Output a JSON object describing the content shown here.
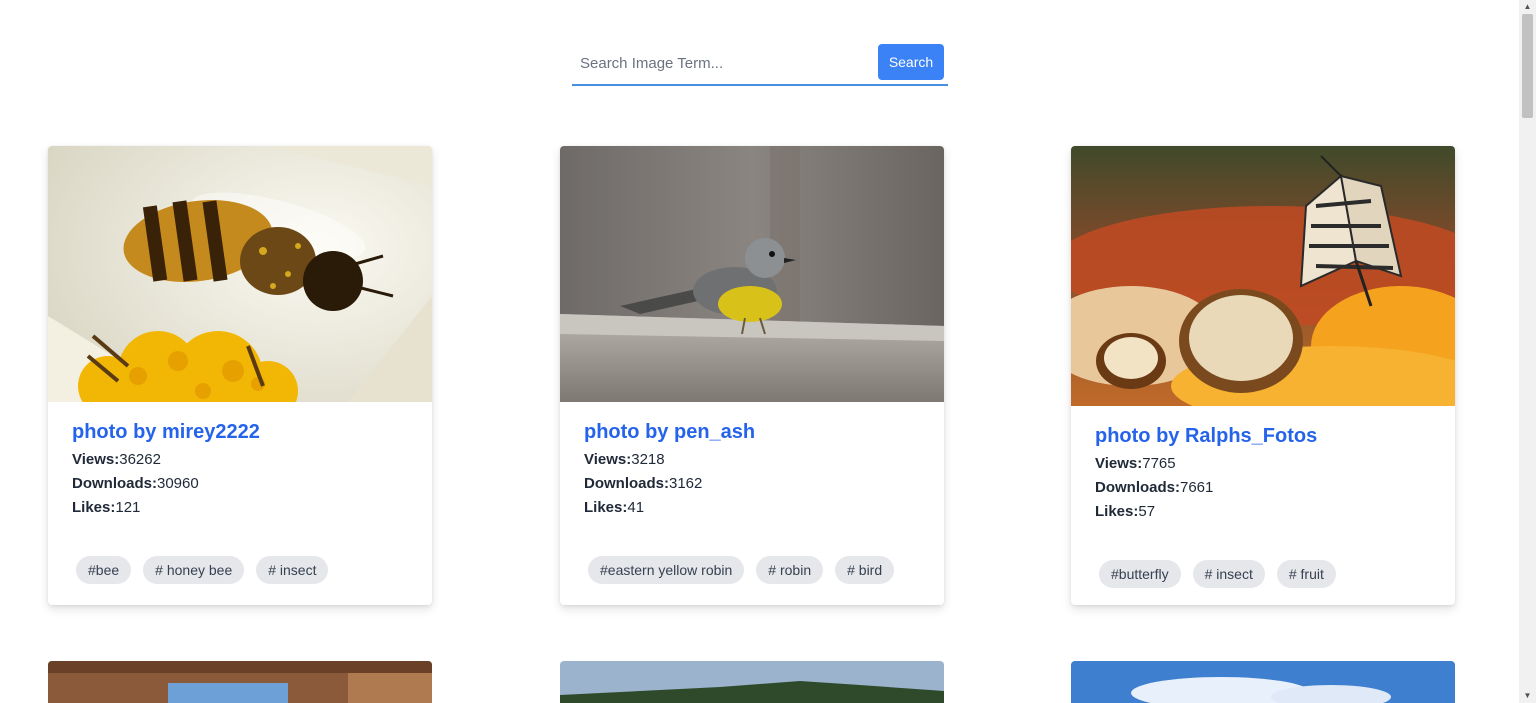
{
  "search": {
    "placeholder": "Search Image Term...",
    "value": "",
    "button_label": "Search"
  },
  "cards": [
    {
      "title": "photo by mirey2222",
      "views_label": "Views:",
      "views": "36262",
      "downloads_label": "Downloads:",
      "downloads": "30960",
      "likes_label": "Likes:",
      "likes": "121",
      "tags": [
        "#bee",
        "# honey bee",
        "# insect"
      ]
    },
    {
      "title": "photo by pen_ash",
      "views_label": "Views:",
      "views": "3218",
      "downloads_label": "Downloads:",
      "downloads": "3162",
      "likes_label": "Likes:",
      "likes": "41",
      "tags": [
        "#eastern yellow robin",
        "# robin",
        "# bird"
      ]
    },
    {
      "title": "photo by Ralphs_Fotos",
      "views_label": "Views:",
      "views": "7765",
      "downloads_label": "Downloads:",
      "downloads": "7661",
      "likes_label": "Likes:",
      "likes": "57",
      "tags": [
        "#butterfly",
        "# insect",
        "# fruit"
      ]
    }
  ],
  "colors": {
    "accent": "#3b82f6",
    "title": "#2563eb",
    "tag_bg": "#e5e7eb"
  }
}
